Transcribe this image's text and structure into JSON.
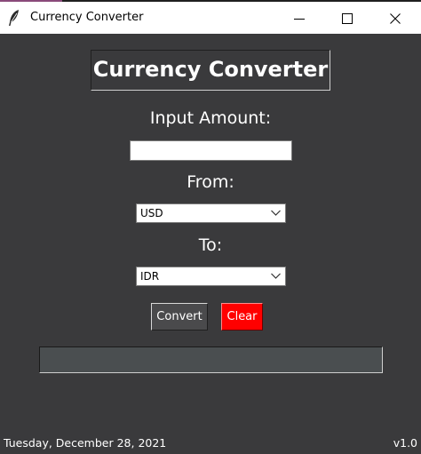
{
  "window": {
    "title": "Currency Converter",
    "app_icon": "feather-icon",
    "controls": {
      "minimize_icon": "minimize-icon",
      "maximize_icon": "maximize-icon",
      "close_icon": "close-icon"
    }
  },
  "main": {
    "heading": "Currency Converter",
    "amount_label": "Input Amount:",
    "amount_value": "",
    "from_label": "From:",
    "from_selected": "USD",
    "to_label": "To:",
    "to_selected": "IDR",
    "convert_label": "Convert",
    "clear_label": "Clear",
    "result_value": ""
  },
  "footer": {
    "date": "Tuesday, December 28, 2021",
    "version": "v1.0"
  },
  "colors": {
    "background": "#3a3a3c",
    "clear_button": "#ff0000",
    "convert_button": "#4a4a4c",
    "result_field": "#4a4e50"
  }
}
